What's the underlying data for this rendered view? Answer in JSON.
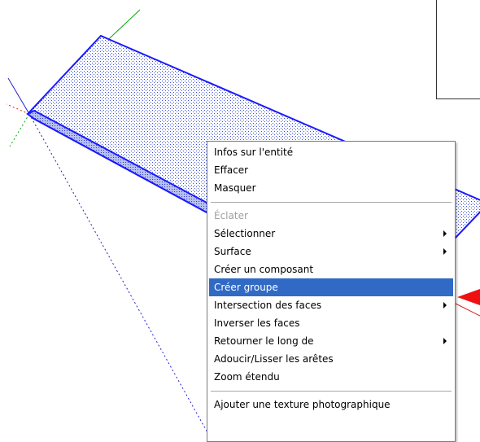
{
  "context_menu": {
    "items": [
      {
        "label": "Infos sur l'entité",
        "enabled": true,
        "submenu": false
      },
      {
        "label": "Effacer",
        "enabled": true,
        "submenu": false
      },
      {
        "label": "Masquer",
        "enabled": true,
        "submenu": false
      },
      {
        "separator": true
      },
      {
        "label": "Éclater",
        "enabled": false,
        "submenu": false
      },
      {
        "label": "Sélectionner",
        "enabled": true,
        "submenu": true
      },
      {
        "label": "Surface",
        "enabled": true,
        "submenu": true
      },
      {
        "label": "Créer un composant",
        "enabled": true,
        "submenu": false
      },
      {
        "label": "Créer groupe",
        "enabled": true,
        "submenu": false,
        "highlighted": true
      },
      {
        "label": "Intersection des faces",
        "enabled": true,
        "submenu": true
      },
      {
        "label": "Inverser les faces",
        "enabled": true,
        "submenu": false
      },
      {
        "label": "Retourner le long de",
        "enabled": true,
        "submenu": true
      },
      {
        "label": "Adoucir/Lisser les arêtes",
        "enabled": true,
        "submenu": false
      },
      {
        "label": "Zoom étendu",
        "enabled": true,
        "submenu": false
      },
      {
        "separator": true
      },
      {
        "label": "Ajouter une texture photographique",
        "enabled": true,
        "submenu": false
      }
    ]
  },
  "colors": {
    "highlight": "#316ac5",
    "selection_edge": "#1a1aff",
    "axis_green": "#00aa00",
    "axis_red": "#dd2222",
    "axis_blue": "#2222cc",
    "pointer_arrow": "#ee1111"
  }
}
